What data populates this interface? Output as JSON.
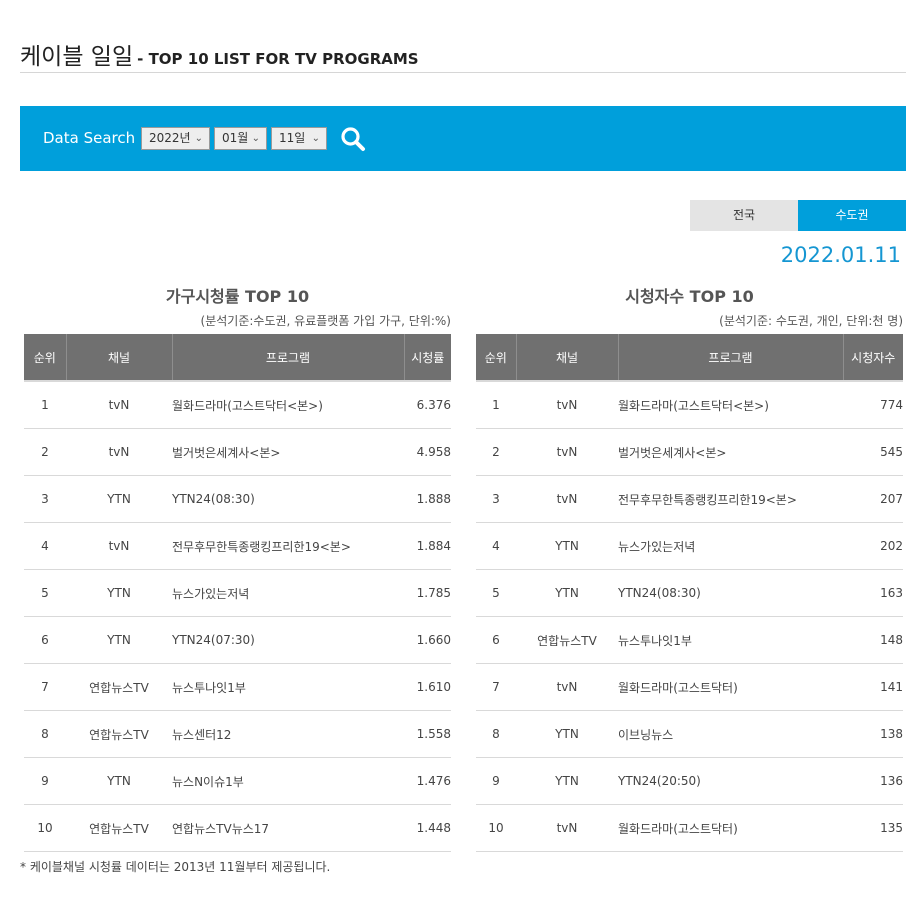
{
  "header": {
    "title_ko": "케이블 일일",
    "title_en": "- TOP 10 LIST FOR TV PROGRAMS"
  },
  "search": {
    "label": "Data Search",
    "year": "2022년",
    "month": "01월",
    "day": "11일"
  },
  "tabs": [
    {
      "label": "전국"
    },
    {
      "label": "수도권"
    }
  ],
  "date": "2022.01.11",
  "household": {
    "title": "가구시청률 TOP 10",
    "note": "(분석기준:수도권, 유료플랫폼 가입 가구, 단위:%)",
    "columns": [
      "순위",
      "채널",
      "프로그램",
      "시청률"
    ],
    "rows": [
      {
        "rank": "1",
        "channel": "tvN",
        "program": "월화드라마(고스트닥터<본>)",
        "value": "6.376"
      },
      {
        "rank": "2",
        "channel": "tvN",
        "program": "벌거벗은세계사<본>",
        "value": "4.958"
      },
      {
        "rank": "3",
        "channel": "YTN",
        "program": "YTN24(08:30)",
        "value": "1.888"
      },
      {
        "rank": "4",
        "channel": "tvN",
        "program": "전무후무한특종랭킹프리한19<본>",
        "value": "1.884"
      },
      {
        "rank": "5",
        "channel": "YTN",
        "program": "뉴스가있는저녁",
        "value": "1.785"
      },
      {
        "rank": "6",
        "channel": "YTN",
        "program": "YTN24(07:30)",
        "value": "1.660"
      },
      {
        "rank": "7",
        "channel": "연합뉴스TV",
        "program": "뉴스투나잇1부",
        "value": "1.610"
      },
      {
        "rank": "8",
        "channel": "연합뉴스TV",
        "program": "뉴스센터12",
        "value": "1.558"
      },
      {
        "rank": "9",
        "channel": "YTN",
        "program": "뉴스N이슈1부",
        "value": "1.476"
      },
      {
        "rank": "10",
        "channel": "연합뉴스TV",
        "program": "연합뉴스TV뉴스17",
        "value": "1.448"
      }
    ]
  },
  "viewers": {
    "title": "시청자수 TOP 10",
    "note": "(분석기준: 수도권, 개인, 단위:천 명)",
    "columns": [
      "순위",
      "채널",
      "프로그램",
      "시청자수"
    ],
    "rows": [
      {
        "rank": "1",
        "channel": "tvN",
        "program": "월화드라마(고스트닥터<본>)",
        "value": "774"
      },
      {
        "rank": "2",
        "channel": "tvN",
        "program": "벌거벗은세계사<본>",
        "value": "545"
      },
      {
        "rank": "3",
        "channel": "tvN",
        "program": "전무후무한특종랭킹프리한19<본>",
        "value": "207"
      },
      {
        "rank": "4",
        "channel": "YTN",
        "program": "뉴스가있는저녁",
        "value": "202"
      },
      {
        "rank": "5",
        "channel": "YTN",
        "program": "YTN24(08:30)",
        "value": "163"
      },
      {
        "rank": "6",
        "channel": "연합뉴스TV",
        "program": "뉴스투나잇1부",
        "value": "148"
      },
      {
        "rank": "7",
        "channel": "tvN",
        "program": "월화드라마(고스트닥터)",
        "value": "141"
      },
      {
        "rank": "8",
        "channel": "YTN",
        "program": "이브닝뉴스",
        "value": "138"
      },
      {
        "rank": "9",
        "channel": "YTN",
        "program": "YTN24(20:50)",
        "value": "136"
      },
      {
        "rank": "10",
        "channel": "tvN",
        "program": "월화드라마(고스트닥터)",
        "value": "135"
      }
    ]
  },
  "footnote": "* 케이블채널 시청률 데이터는 2013년 11월부터 제공됩니다.",
  "colors": {
    "accent": "#009fdb",
    "value_text": "#1596d2",
    "table_header": "#707070",
    "tab_inactive": "#e4e4e4"
  }
}
